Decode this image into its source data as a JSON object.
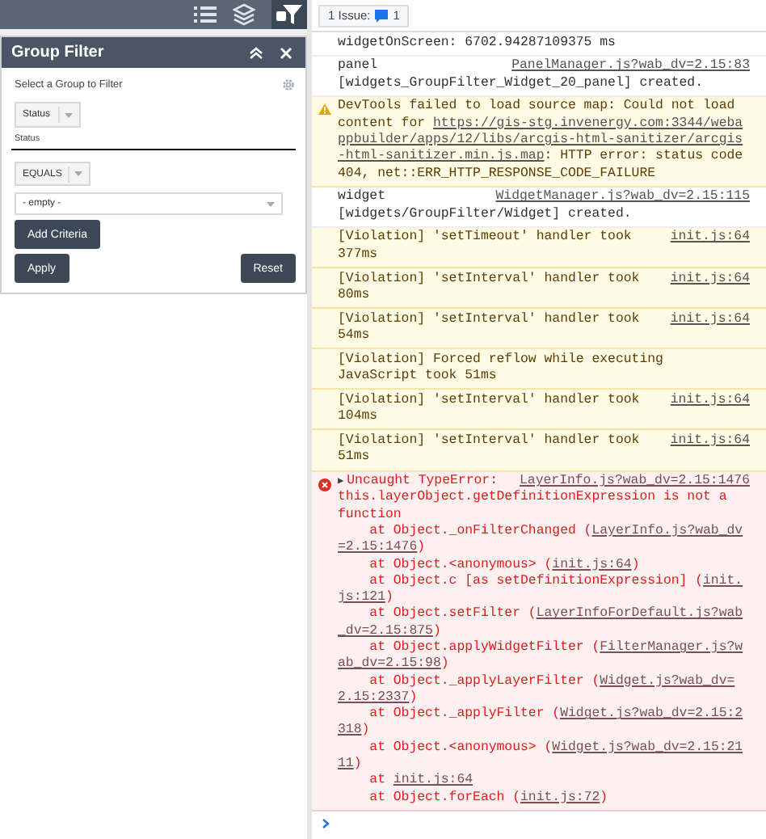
{
  "panel": {
    "title": "Group Filter",
    "group_label": "Select a Group to Filter",
    "group_select": {
      "value": "Status"
    },
    "field_label": "Status",
    "operator_select": {
      "value": "EQUALS"
    },
    "value_select": {
      "value": "- empty -"
    },
    "add_button": "Add Criteria",
    "apply_button": "Apply",
    "reset_button": "Reset"
  },
  "console": {
    "issues_button": {
      "label": "1 Issue:",
      "count": "1"
    },
    "messages": [
      {
        "kind": "info",
        "lines": [
          [
            "widgetOnScreen: 6702.94287109375 ms"
          ]
        ]
      },
      {
        "kind": "info",
        "source": "PanelManager.js?wab_dv=2.15:83",
        "lines": [
          [
            "panel"
          ],
          [
            "[widgets_GroupFilter_Widget_20_panel] created."
          ]
        ]
      },
      {
        "kind": "warning",
        "lines": [
          [
            "DevTools failed to load source map: Could not load"
          ],
          [
            "content for ",
            {
              "link": "https://gis-stg.invenergy.com:3344/weba"
            }
          ],
          [
            {
              "link": "ppbuilder/apps/12/libs/arcgis-html-sanitizer/arcgis"
            }
          ],
          [
            {
              "link": "-html-sanitizer.min.js.map"
            },
            ": HTTP error: status code"
          ],
          [
            "404, net::ERR_HTTP_RESPONSE_CODE_FAILURE"
          ]
        ]
      },
      {
        "kind": "info",
        "source": "WidgetManager.js?wab_dv=2.15:115",
        "lines": [
          [
            "widget"
          ],
          [
            "[widgets/GroupFilter/Widget] created."
          ]
        ]
      },
      {
        "kind": "violation",
        "source": "init.js:64",
        "lines": [
          [
            "[Violation] 'setTimeout' handler took"
          ],
          [
            "377ms"
          ]
        ]
      },
      {
        "kind": "violation",
        "source": "init.js:64",
        "lines": [
          [
            "[Violation] 'setInterval' handler took"
          ],
          [
            "80ms"
          ]
        ]
      },
      {
        "kind": "violation",
        "source": "init.js:64",
        "lines": [
          [
            "[Violation] 'setInterval' handler took"
          ],
          [
            "54ms"
          ]
        ]
      },
      {
        "kind": "violation",
        "lines": [
          [
            "[Violation] Forced reflow while executing"
          ],
          [
            "JavaScript took 51ms"
          ]
        ]
      },
      {
        "kind": "violation",
        "source": "init.js:64",
        "lines": [
          [
            "[Violation] 'setInterval' handler took"
          ],
          [
            "104ms"
          ]
        ]
      },
      {
        "kind": "violation",
        "source": "init.js:64",
        "lines": [
          [
            "[Violation] 'setInterval' handler took"
          ],
          [
            "51ms"
          ]
        ]
      },
      {
        "kind": "error",
        "expander": "▶",
        "source": "LayerInfo.js?wab_dv=2.15:1476",
        "lines": [
          [
            "Uncaught TypeError:"
          ],
          [
            "this.layerObject.getDefinitionExpression is not a"
          ],
          [
            "function"
          ],
          [
            "    at Object._onFilterChanged (",
            {
              "link": "LayerInfo.js?wab_dv"
            }
          ],
          [
            {
              "link": "=2.15:1476"
            },
            ")"
          ],
          [
            "    at Object.<anonymous> (",
            {
              "link": "init.js:64"
            },
            ")"
          ],
          [
            "    at Object.c [as setDefinitionExpression] (",
            {
              "link": "init."
            }
          ],
          [
            {
              "link": "js:121"
            },
            ")"
          ],
          [
            "    at Object.setFilter (",
            {
              "link": "LayerInfoForDefault.js?wab"
            }
          ],
          [
            {
              "link": "_dv=2.15:875"
            },
            ")"
          ],
          [
            "    at Object.applyWidgetFilter (",
            {
              "link": "FilterManager.js?w"
            }
          ],
          [
            {
              "link": "ab_dv=2.15:98"
            },
            ")"
          ],
          [
            "    at Object._applyLayerFilter (",
            {
              "link": "Widget.js?wab_dv="
            }
          ],
          [
            {
              "link": "2.15:2337"
            },
            ")"
          ],
          [
            "    at Object._applyFilter (",
            {
              "link": "Widget.js?wab_dv=2.15:2"
            }
          ],
          [
            {
              "link": "318"
            },
            ")"
          ],
          [
            "    at Object.<anonymous> (",
            {
              "link": "Widget.js?wab_dv=2.15:21"
            }
          ],
          [
            {
              "link": "11"
            },
            ")"
          ],
          [
            "    at ",
            {
              "link": "init.js:64"
            }
          ],
          [
            "    at Object.forEach (",
            {
              "link": "init.js:72"
            },
            ")"
          ]
        ]
      }
    ]
  }
}
